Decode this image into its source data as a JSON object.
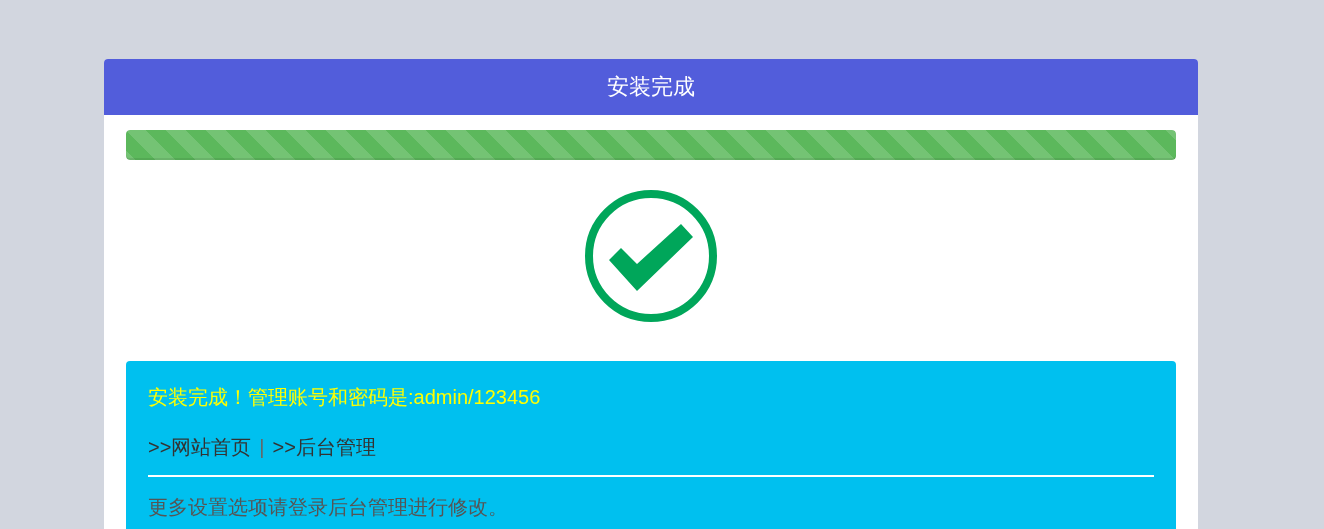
{
  "header": {
    "title": "安装完成"
  },
  "progress": {
    "level": 1
  },
  "message": {
    "text": "安装完成！管理账号和密码是:admin/123456",
    "links": [
      {
        "label": ">>网站首页"
      },
      {
        "label": ">>后台管理"
      }
    ],
    "separator": "|",
    "note": "更多设置选项请登录后台管理进行修改。"
  }
}
